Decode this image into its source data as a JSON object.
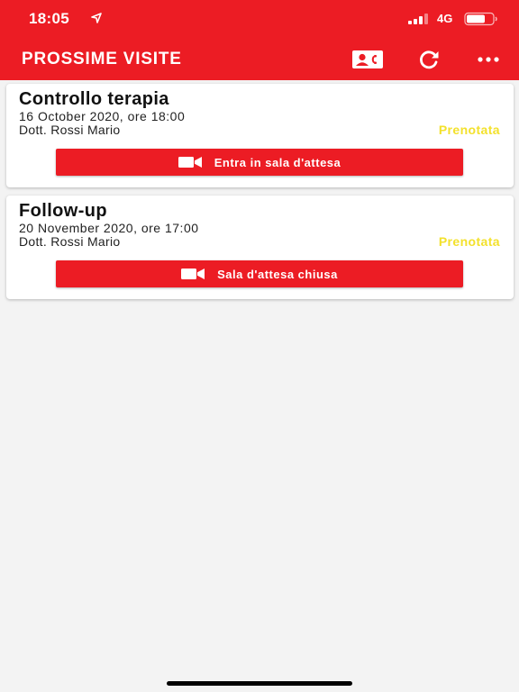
{
  "status_bar": {
    "time": "18:05",
    "network": "4G",
    "icons": [
      "location-arrow-icon",
      "signal-icon",
      "battery-icon"
    ]
  },
  "app_bar": {
    "title": "PROSSIME VISITE",
    "actions": [
      "contact-card-icon",
      "refresh-icon",
      "more-icon"
    ]
  },
  "visits": [
    {
      "title": "Controllo terapia",
      "date": "16 October 2020, ore 18:00",
      "doctor": "Dott. Rossi Mario",
      "status": "Prenotata",
      "action_label": "Entra in sala d'attesa"
    },
    {
      "title": "Follow-up",
      "date": "20 November 2020, ore 17:00",
      "doctor": "Dott. Rossi Mario",
      "status": "Prenotata",
      "action_label": "Sala d'attesa chiusa"
    }
  ],
  "colors": {
    "primary": "#ec1c24",
    "status_booked": "#f3e12c",
    "background": "#f3f3f3"
  }
}
